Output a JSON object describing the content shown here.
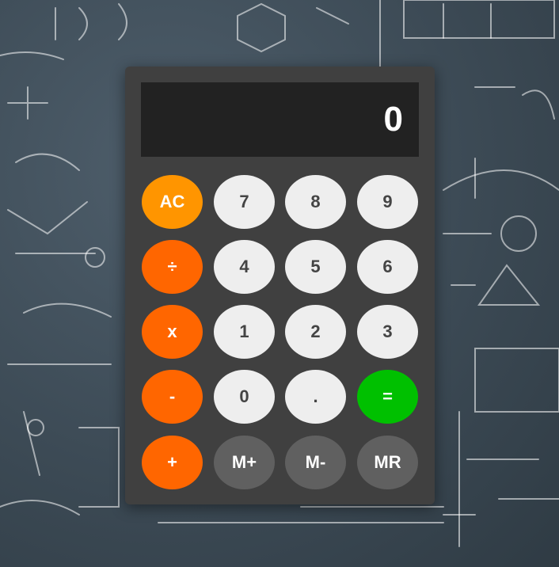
{
  "display": {
    "value": "0"
  },
  "keys": {
    "ac": "AC",
    "divide": "÷",
    "multiply": "x",
    "subtract": "-",
    "add": "+",
    "seven": "7",
    "eight": "8",
    "nine": "9",
    "four": "4",
    "five": "5",
    "six": "6",
    "one": "1",
    "two": "2",
    "three": "3",
    "zero": "0",
    "decimal": ".",
    "equals": "=",
    "mem_add": "M+",
    "mem_sub": "M-",
    "mem_recall": "MR"
  },
  "colors": {
    "clear": "#ff9500",
    "operator": "#ff6600",
    "equals": "#00c000",
    "number": "#eeeeee",
    "memory": "#606060",
    "body": "#404040",
    "display": "#222222"
  }
}
